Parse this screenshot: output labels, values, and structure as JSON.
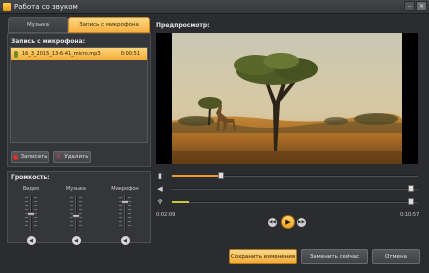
{
  "window": {
    "title": "Работа со звуком"
  },
  "tabs": [
    {
      "label": "Музыка",
      "active": false
    },
    {
      "label": "Запись с микрофона",
      "active": true
    }
  ],
  "recording": {
    "section_label": "Запись с микрофона:",
    "files": [
      {
        "name": "16_3_2015_13-6-41_micro.mp3",
        "duration": "0:00:51",
        "icon": "microphone-icon"
      }
    ],
    "record_button": "Записать",
    "delete_button": "Удалить"
  },
  "volume": {
    "section_label": "Громкость:",
    "channels": [
      {
        "label": "Видео",
        "level": 0.55
      },
      {
        "label": "Музыка",
        "level": 0.45
      },
      {
        "label": "Микрофон",
        "level": 0.8
      }
    ]
  },
  "preview": {
    "section_label": "Предпросмотр:",
    "seek_position": 0.2,
    "volume_level": 0.0,
    "mic_level": 0.07,
    "current_time": "0:02:09",
    "total_time": "0:10:57"
  },
  "footer": {
    "save_button": "Сохранить изменения",
    "replace_button": "Заменить сейчас",
    "cancel_button": "Отмена"
  },
  "colors": {
    "accent": "#f5b041",
    "window_bg": "#2b2c2f",
    "panel_bg": "#34363a"
  }
}
